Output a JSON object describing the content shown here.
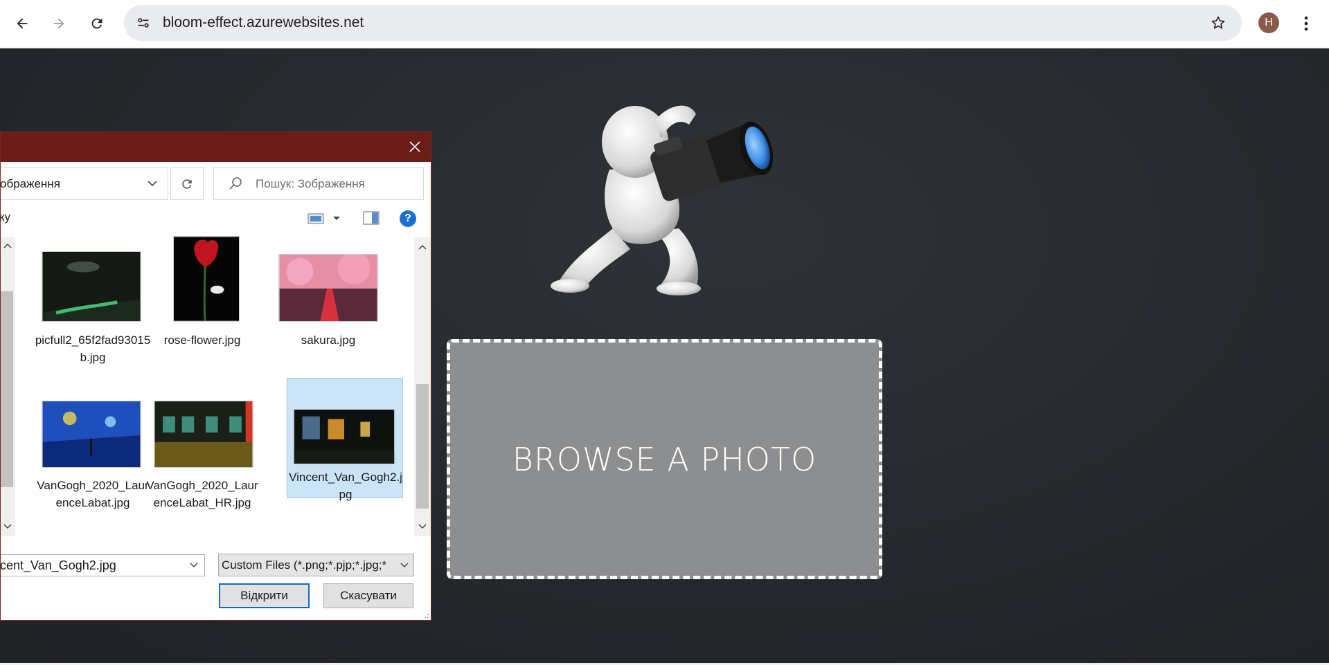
{
  "browser": {
    "url": "bloom-effect.azurewebsites.net",
    "profile_initial": "H"
  },
  "page": {
    "dropzone_label": "BROWSE A PHOTO"
  },
  "dialog": {
    "address_text": "ображення",
    "search_placeholder": "Пошук: Зображення",
    "toolbar_left_text": "ку",
    "help_label": "?",
    "files": [
      {
        "caption": "picfull2_65f2fad93015b.jpg",
        "selected": false
      },
      {
        "caption": "rose-flower.jpg",
        "selected": false
      },
      {
        "caption": "sakura.jpg",
        "selected": false
      },
      {
        "caption": "VanGogh_2020_LaurenceLabat.jpg",
        "selected": false
      },
      {
        "caption": "VanGogh_2020_LaurenceLabat_HR.jpg",
        "selected": false
      },
      {
        "caption": "Vincent_Van_Gogh2.jpg",
        "selected": true
      }
    ],
    "filename_value": "cent_Van_Gogh2.jpg",
    "filetype_value": "Custom Files (*.png;*.pjp;*.jpg;*",
    "open_label": "Відкрити",
    "cancel_label": "Скасувати"
  },
  "colors": {
    "dialog_title_bar": "#6b1d17",
    "page_background": "#26292d",
    "dropzone": "#8d8e90",
    "selection": "#cce4f7",
    "primary_button_border": "#0f6cbd"
  }
}
